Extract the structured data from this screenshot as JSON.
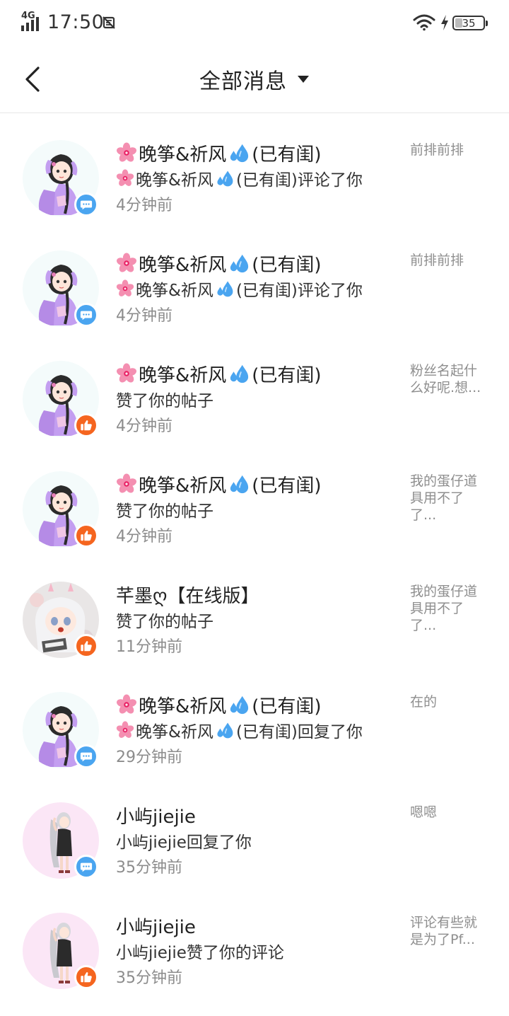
{
  "status_bar": {
    "network": "4G",
    "time": "17:50",
    "battery": "35"
  },
  "header": {
    "title": "全部消息"
  },
  "colors": {
    "comment_badge": "#4aa5f0",
    "like_badge": "#f5651f"
  },
  "messages": [
    {
      "name": "晚筝&祈风",
      "name_suffix": "(已有闺)",
      "action_name": "晚筝&祈风",
      "action_suffix": "(已有闺)评论了你",
      "time": "4分钟前",
      "preview": "前排前排",
      "badge": "comment-icon"
    },
    {
      "name": "晚筝&祈风",
      "name_suffix": "(已有闺)",
      "action_name": "晚筝&祈风",
      "action_suffix": "(已有闺)评论了你",
      "time": "4分钟前",
      "preview": "前排前排",
      "badge": "comment-icon"
    },
    {
      "name": "晚筝&祈风",
      "name_suffix": "(已有闺)",
      "action": "赞了你的帖子",
      "time": "4分钟前",
      "preview": "粉丝名起什么好呢.想...",
      "badge": "thumbs-up-icon"
    },
    {
      "name": "晚筝&祈风",
      "name_suffix": "(已有闺)",
      "action": "赞了你的帖子",
      "time": "4分钟前",
      "preview": "我的蛋仔道具用不了了...",
      "badge": "thumbs-up-icon"
    },
    {
      "name": "芊墨ღ【在线版】",
      "action": "赞了你的帖子",
      "time": "11分钟前",
      "preview": "我的蛋仔道具用不了了...",
      "badge": "thumbs-up-icon"
    },
    {
      "name": "晚筝&祈风",
      "name_suffix": "(已有闺)",
      "action_name": "晚筝&祈风",
      "action_suffix": "(已有闺)回复了你",
      "time": "29分钟前",
      "preview": "在的",
      "badge": "comment-icon"
    },
    {
      "name": "小屿jiejie",
      "action": "小屿jiejie回复了你",
      "time": "35分钟前",
      "preview": "嗯嗯",
      "badge": "comment-icon"
    },
    {
      "name": "小屿jiejie",
      "action": "小屿jiejie赞了你的评论",
      "time": "35分钟前",
      "preview": "评论有些就是为了Pf...",
      "badge": "thumbs-up-icon"
    }
  ]
}
